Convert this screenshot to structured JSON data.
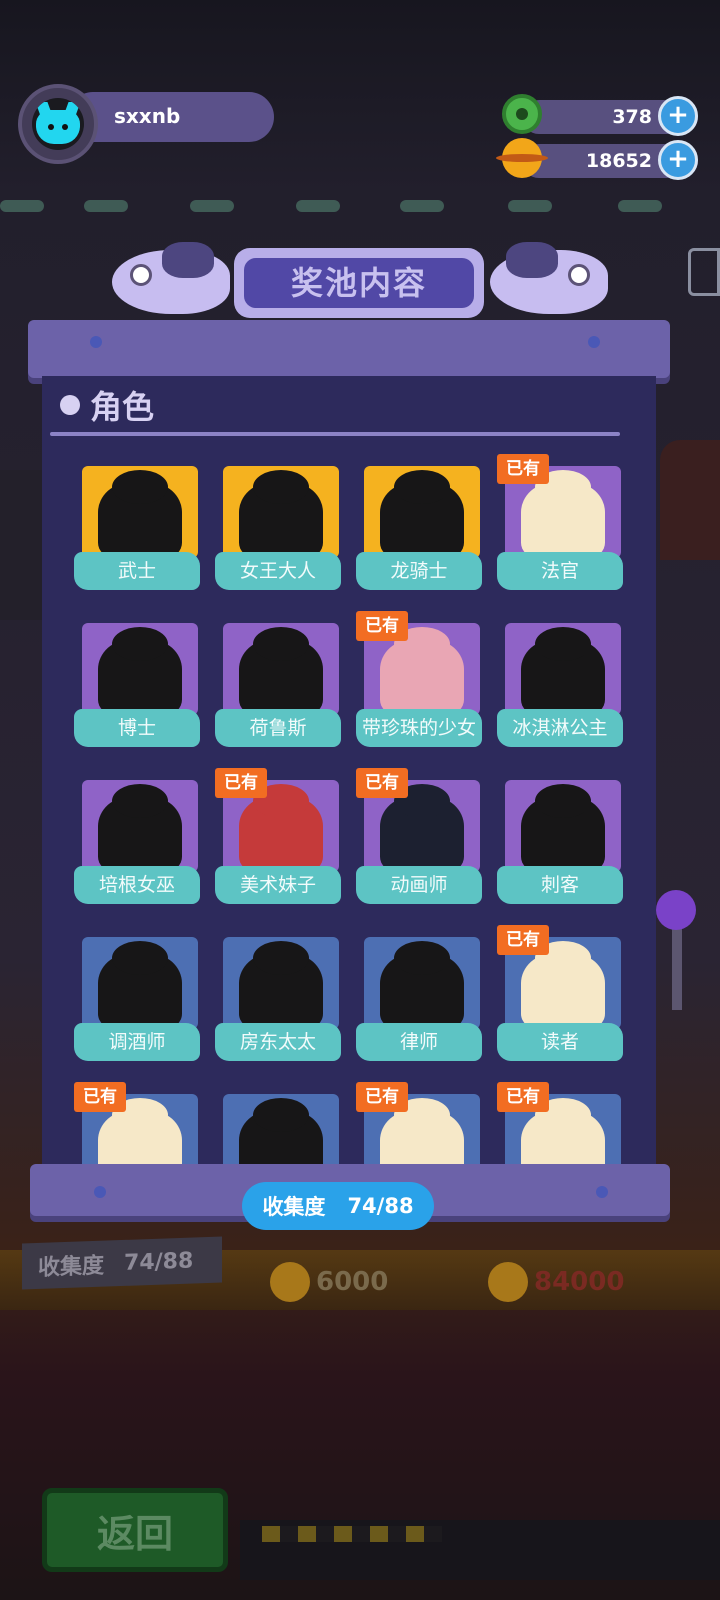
{
  "user": {
    "name": "sxxnb"
  },
  "currencies": {
    "donut": {
      "value": "378",
      "icon": "donut-icon",
      "add_label": "+"
    },
    "coin": {
      "value": "18652",
      "icon": "planet-coin-icon",
      "add_label": "+"
    }
  },
  "panel": {
    "title": "奖池内容",
    "section": "角色",
    "owned_badge": "已有",
    "characters": [
      {
        "name": "武士",
        "rarity": "gold",
        "owned": false
      },
      {
        "name": "女王大人",
        "rarity": "gold",
        "owned": false
      },
      {
        "name": "龙骑士",
        "rarity": "gold",
        "owned": false
      },
      {
        "name": "法官",
        "rarity": "purple",
        "owned": true
      },
      {
        "name": "博士",
        "rarity": "purple",
        "owned": false
      },
      {
        "name": "荷鲁斯",
        "rarity": "purple",
        "owned": false
      },
      {
        "name": "带珍珠的少女",
        "rarity": "purple",
        "owned": true
      },
      {
        "name": "冰淇淋公主",
        "rarity": "purple",
        "owned": false
      },
      {
        "name": "培根女巫",
        "rarity": "purple",
        "owned": false
      },
      {
        "name": "美术妹子",
        "rarity": "purple",
        "owned": true
      },
      {
        "name": "动画师",
        "rarity": "purple",
        "owned": true
      },
      {
        "name": "刺客",
        "rarity": "purple",
        "owned": false
      },
      {
        "name": "调酒师",
        "rarity": "blue",
        "owned": false
      },
      {
        "name": "房东太太",
        "rarity": "blue",
        "owned": false
      },
      {
        "name": "律师",
        "rarity": "blue",
        "owned": false
      },
      {
        "name": "读者",
        "rarity": "blue",
        "owned": true
      },
      {
        "name": "",
        "rarity": "blue",
        "owned": true
      },
      {
        "name": "",
        "rarity": "blue",
        "owned": false
      },
      {
        "name": "",
        "rarity": "blue",
        "owned": true
      },
      {
        "name": "",
        "rarity": "blue",
        "owned": true
      }
    ],
    "collection": {
      "label": "收集度",
      "value": "74/88"
    }
  },
  "background": {
    "counter_label": "收集度",
    "counter_value": "74/88",
    "price_1": "6000",
    "price_2": "84000",
    "return_label": "返回"
  }
}
